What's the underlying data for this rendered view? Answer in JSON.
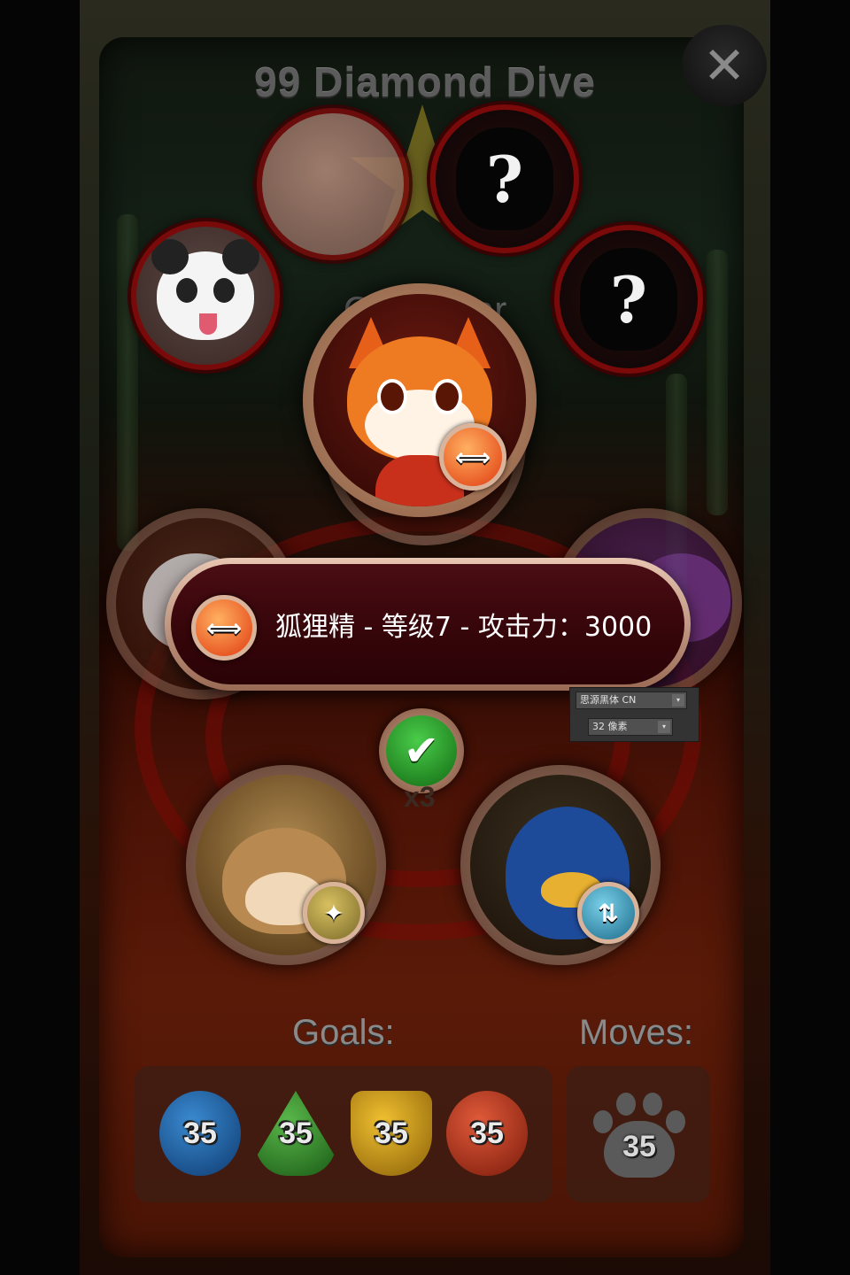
{
  "header": {
    "title": "99 Diamond Dive",
    "close_label": "✕"
  },
  "team_selection": {
    "subtitle": "Choo          tear",
    "locked_mark": "?"
  },
  "featured": {
    "name": "狐狸精",
    "skill_badge": "⟺"
  },
  "tooltip": {
    "text": "狐狸精 - 等级7 - 攻击力：3000",
    "badge": "⟺"
  },
  "editor_overlay": {
    "font_name": "思源黑体 CN",
    "font_size": "32 像素"
  },
  "confirm": {
    "label": "✔",
    "multiplier": "x3"
  },
  "members": {
    "monkey_badge": "✦",
    "penguin_badge": "⇅"
  },
  "goals": {
    "label": "Goals:",
    "items": [
      {
        "value": "35",
        "color": "#1e6ab0"
      },
      {
        "value": "35",
        "color": "#2e8a2a"
      },
      {
        "value": "35",
        "color": "#c89a18"
      },
      {
        "value": "35",
        "color": "#b8301c"
      }
    ]
  },
  "moves": {
    "label": "Moves:",
    "value": "35"
  }
}
